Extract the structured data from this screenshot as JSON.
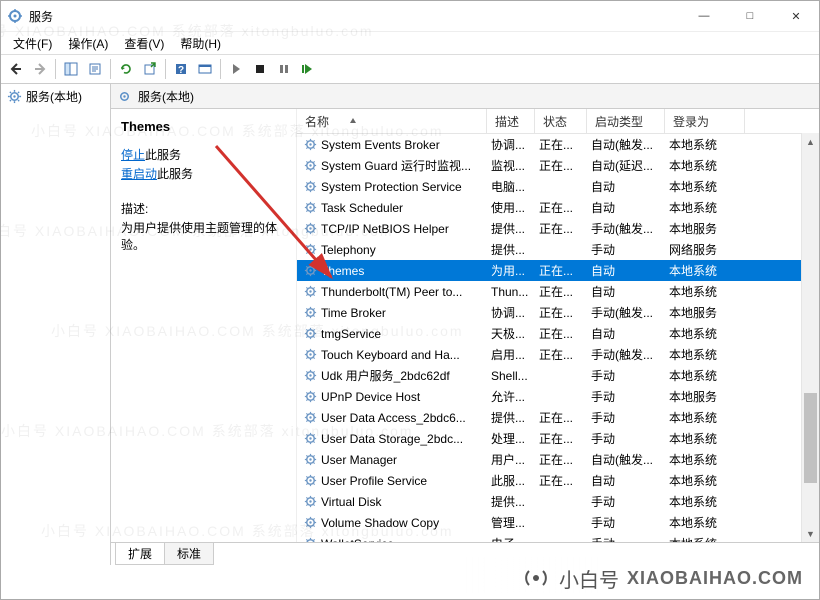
{
  "window": {
    "title": "服务"
  },
  "menu": {
    "file": "文件(F)",
    "action": "操作(A)",
    "view": "查看(V)",
    "help": "帮助(H)"
  },
  "nav": {
    "root": "服务(本地)"
  },
  "mainheader": "服务(本地)",
  "detail": {
    "selected_name": "Themes",
    "stop_prefix": "停止",
    "stop_suffix": "此服务",
    "restart_prefix": "重启动",
    "restart_suffix": "此服务",
    "desc_label": "描述:",
    "desc_text": "为用户提供使用主题管理的体验。"
  },
  "columns": {
    "name": "名称",
    "desc": "描述",
    "status": "状态",
    "startup": "启动类型",
    "logon": "登录为"
  },
  "services": [
    {
      "name": "System Events Broker",
      "desc": "协调...",
      "status": "正在...",
      "startup": "自动(触发...",
      "logon": "本地系统"
    },
    {
      "name": "System Guard 运行时监视...",
      "desc": "监视...",
      "status": "正在...",
      "startup": "自动(延迟...",
      "logon": "本地系统"
    },
    {
      "name": "System Protection Service",
      "desc": "电脑...",
      "status": "",
      "startup": "自动",
      "logon": "本地系统"
    },
    {
      "name": "Task Scheduler",
      "desc": "使用...",
      "status": "正在...",
      "startup": "自动",
      "logon": "本地系统"
    },
    {
      "name": "TCP/IP NetBIOS Helper",
      "desc": "提供...",
      "status": "正在...",
      "startup": "手动(触发...",
      "logon": "本地服务"
    },
    {
      "name": "Telephony",
      "desc": "提供...",
      "status": "",
      "startup": "手动",
      "logon": "网络服务"
    },
    {
      "name": "Themes",
      "desc": "为用...",
      "status": "正在...",
      "startup": "自动",
      "logon": "本地系统",
      "selected": true
    },
    {
      "name": "Thunderbolt(TM) Peer to...",
      "desc": "Thun...",
      "status": "正在...",
      "startup": "自动",
      "logon": "本地系统"
    },
    {
      "name": "Time Broker",
      "desc": "协调...",
      "status": "正在...",
      "startup": "手动(触发...",
      "logon": "本地服务"
    },
    {
      "name": "tmgService",
      "desc": "天极...",
      "status": "正在...",
      "startup": "自动",
      "logon": "本地系统"
    },
    {
      "name": "Touch Keyboard and Ha...",
      "desc": "启用...",
      "status": "正在...",
      "startup": "手动(触发...",
      "logon": "本地系统"
    },
    {
      "name": "Udk 用户服务_2bdc62df",
      "desc": "Shell...",
      "status": "",
      "startup": "手动",
      "logon": "本地系统"
    },
    {
      "name": "UPnP Device Host",
      "desc": "允许...",
      "status": "",
      "startup": "手动",
      "logon": "本地服务"
    },
    {
      "name": "User Data Access_2bdc6...",
      "desc": "提供...",
      "status": "正在...",
      "startup": "手动",
      "logon": "本地系统"
    },
    {
      "name": "User Data Storage_2bdc...",
      "desc": "处理...",
      "status": "正在...",
      "startup": "手动",
      "logon": "本地系统"
    },
    {
      "name": "User Manager",
      "desc": "用户...",
      "status": "正在...",
      "startup": "自动(触发...",
      "logon": "本地系统"
    },
    {
      "name": "User Profile Service",
      "desc": "此服...",
      "status": "正在...",
      "startup": "自动",
      "logon": "本地系统"
    },
    {
      "name": "Virtual Disk",
      "desc": "提供...",
      "status": "",
      "startup": "手动",
      "logon": "本地系统"
    },
    {
      "name": "Volume Shadow Copy",
      "desc": "管理...",
      "status": "",
      "startup": "手动",
      "logon": "本地系统"
    },
    {
      "name": "WalletService",
      "desc": "电子...",
      "status": "",
      "startup": "手动",
      "logon": "本地系统"
    }
  ],
  "tabs": {
    "extended": "扩展",
    "standard": "标准"
  },
  "brand": {
    "name": "小白号",
    "domain": "XIAOBAIHAO.COM"
  },
  "watermark": "小白号  XIAOBAIHAO.COM  系统部落 xitongbuluo.com",
  "icons": {
    "min": "—",
    "max": "□",
    "close": "✕"
  }
}
